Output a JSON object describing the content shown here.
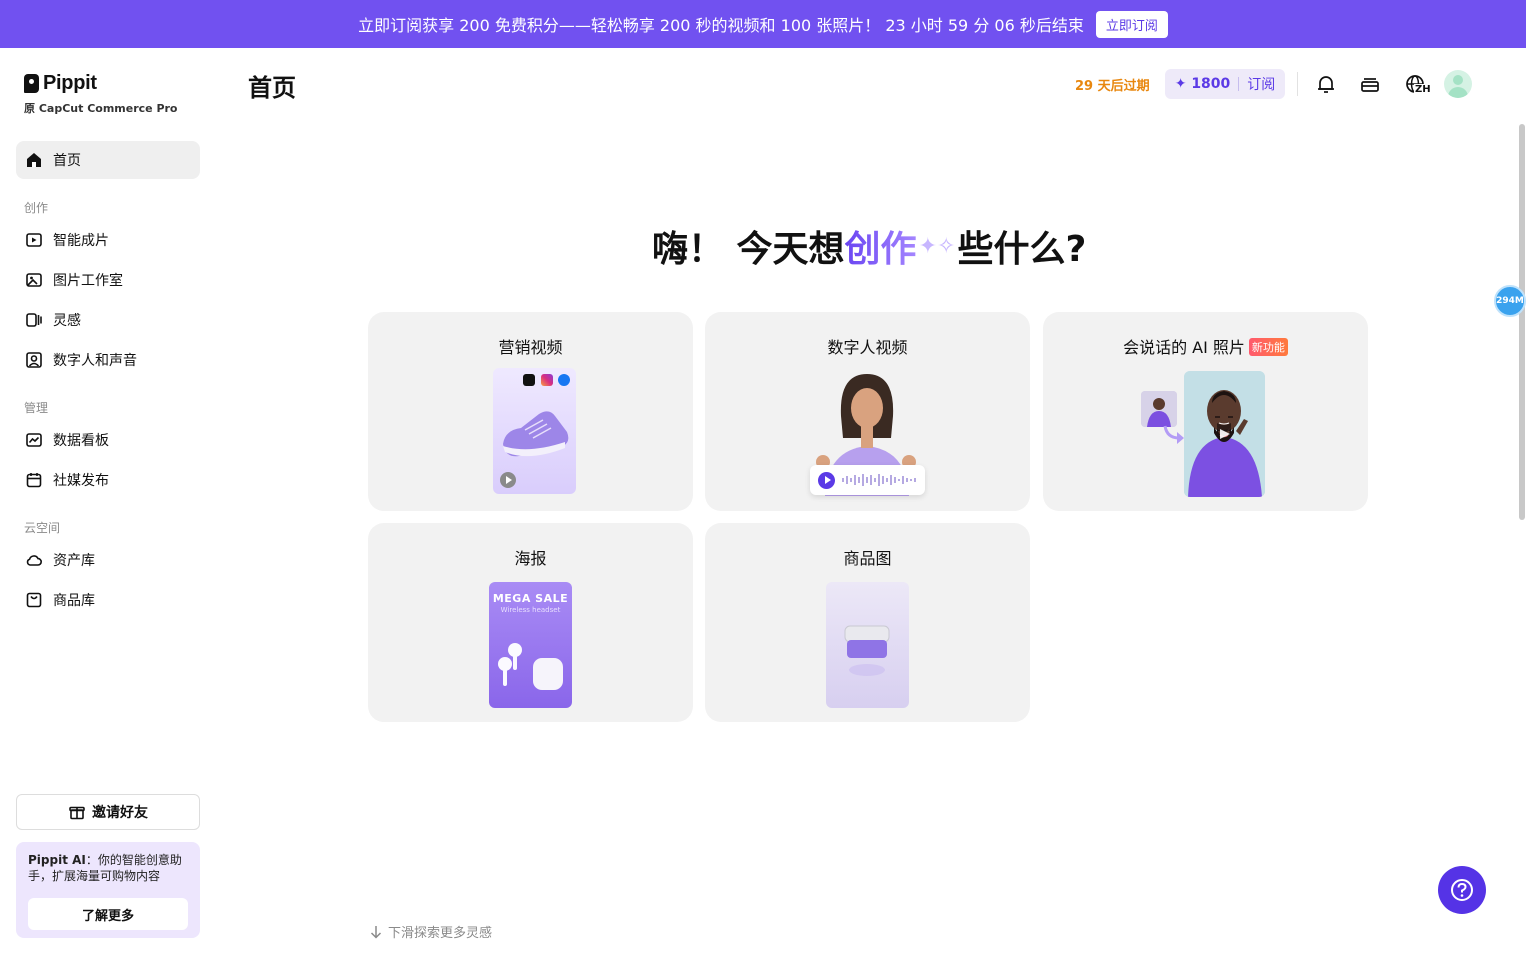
{
  "banner": {
    "text": "立即订阅获享 200 免费积分——轻松畅享 200 秒的视频和 100 张照片！ 23 小时 59 分 06 秒后结束",
    "button": "立即订阅",
    "background": "#7151f0"
  },
  "sidebar": {
    "logo": "Pippit",
    "logo_sub": "原 CapCut Commerce Pro",
    "home": {
      "label": "首页",
      "icon": "home-icon"
    },
    "sections": [
      {
        "label": "创作",
        "items": [
          {
            "label": "智能成片",
            "icon": "smart-video-icon"
          },
          {
            "label": "图片工作室",
            "icon": "image-studio-icon"
          },
          {
            "label": "灵感",
            "icon": "inspiration-icon"
          },
          {
            "label": "数字人和声音",
            "icon": "avatar-voice-icon"
          }
        ]
      },
      {
        "label": "管理",
        "items": [
          {
            "label": "数据看板",
            "icon": "analytics-icon"
          },
          {
            "label": "社媒发布",
            "icon": "calendar-icon"
          }
        ]
      },
      {
        "label": "云空间",
        "items": [
          {
            "label": "资产库",
            "icon": "cloud-icon"
          },
          {
            "label": "商品库",
            "icon": "product-library-icon"
          }
        ]
      }
    ],
    "invite": "邀请好友",
    "ai_card": {
      "brand": "Pippit AI",
      "text": "：你的智能创意助手，扩展海量可购物内容",
      "button": "了解更多"
    }
  },
  "header": {
    "title": "首页",
    "expire": "29 天后过期",
    "credits": "1800",
    "subscribe": "订阅",
    "lang": "ZH"
  },
  "hero": {
    "part1": "嗨！ 今天想",
    "accent": "创作",
    "part2": "些什么?"
  },
  "cards": [
    {
      "title": "营销视频"
    },
    {
      "title": "数字人视频"
    },
    {
      "title": "会说话的 AI 照片",
      "badge": "新功能"
    },
    {
      "title": "海报",
      "poster_title": "MEGA SALE",
      "poster_sub": "Wireless headset"
    },
    {
      "title": "商品图"
    }
  ],
  "memory_badge": "294M",
  "scroll_hint": "下滑探索更多灵感",
  "colors": {
    "accent": "#5b3ae6",
    "expire": "#e8870f",
    "help": "#5533e6"
  }
}
